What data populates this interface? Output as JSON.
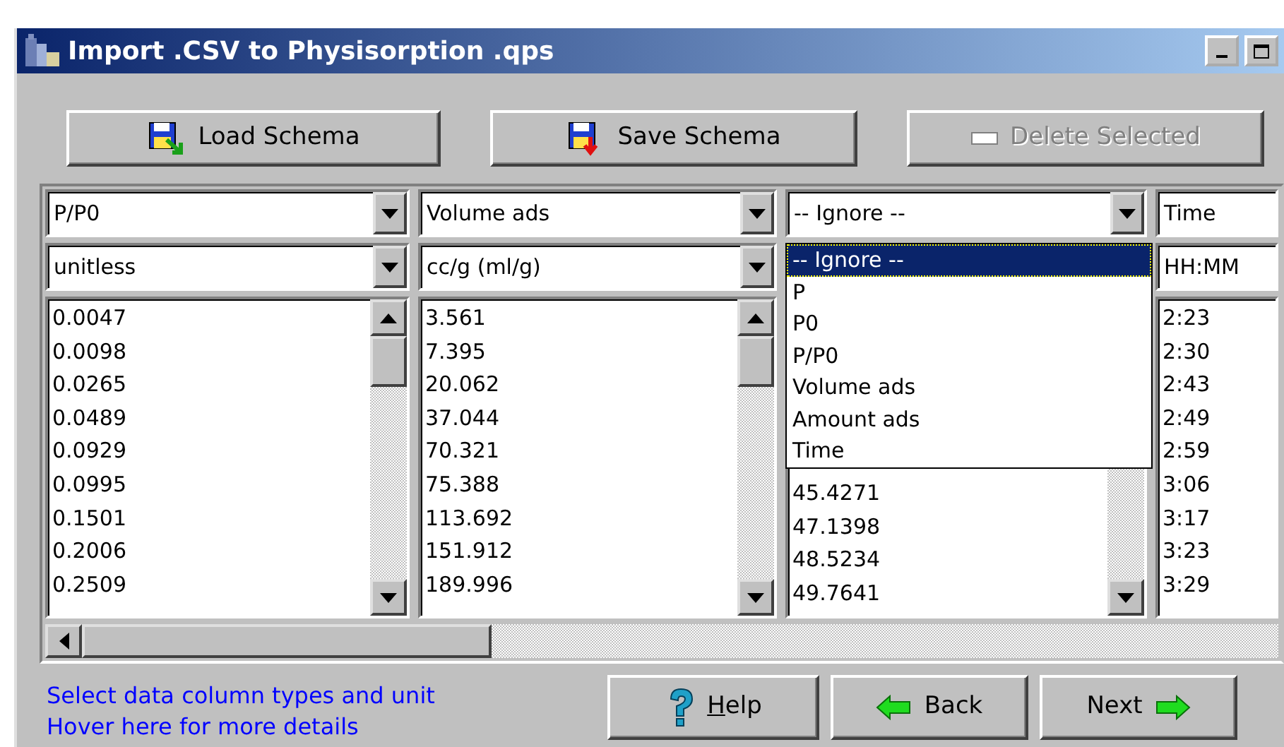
{
  "window": {
    "title": "Import .CSV to Physisorption .qps"
  },
  "toolbar": [
    {
      "label": "Load Schema",
      "kind": "load",
      "disabled": false
    },
    {
      "label": "Save Schema",
      "kind": "save",
      "disabled": false
    },
    {
      "label": "Delete Selected",
      "kind": "delete",
      "disabled": true
    }
  ],
  "columns": [
    {
      "type": "P/P0",
      "unit": "unitless",
      "values": [
        "0.0047",
        "0.0098",
        "0.0265",
        "0.0489",
        "0.0929",
        "0.0995",
        "0.1501",
        "0.2006",
        "0.2509"
      ]
    },
    {
      "type": "Volume ads",
      "unit": "cc/g (ml/g)",
      "values": [
        "3.561",
        "7.395",
        "20.062",
        "37.044",
        "70.321",
        "75.388",
        "113.692",
        "151.912",
        "189.996"
      ]
    },
    {
      "type": "-- Ignore --",
      "values": [
        "45.4271",
        "47.1398",
        "48.5234",
        "49.7641"
      ],
      "dropdown": [
        {
          "label": "-- Ignore --",
          "selected": true
        },
        {
          "label": "P",
          "selected": false
        },
        {
          "label": "P0",
          "selected": false
        },
        {
          "label": "P/P0",
          "selected": false
        },
        {
          "label": "Volume ads",
          "selected": false
        },
        {
          "label": "Amount ads",
          "selected": false
        },
        {
          "label": "Time",
          "selected": false
        }
      ]
    },
    {
      "type": "Time",
      "unit": "HH:MM",
      "values": [
        "2:23",
        "2:30",
        "2:43",
        "2:49",
        "2:59",
        "3:06",
        "3:17",
        "3:23",
        "3:29"
      ]
    }
  ],
  "hints": [
    "Select data column types and unit",
    "Hover here for more details"
  ],
  "nav_buttons": [
    {
      "label": "Help",
      "kind": "help"
    },
    {
      "label": "Back",
      "kind": "back"
    },
    {
      "label": "Next",
      "kind": "next"
    }
  ]
}
